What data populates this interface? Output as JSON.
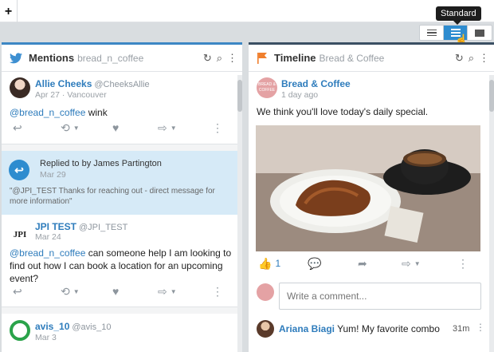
{
  "topbar": {
    "plus_label": "+"
  },
  "tooltip": {
    "label": "Standard"
  },
  "view_toggle": {
    "items": [
      "list",
      "standard",
      "wide"
    ],
    "active": "standard"
  },
  "mentions": {
    "title": "Mentions",
    "subtitle": "bread_n_coffee",
    "tweets": [
      {
        "name": "Allie Cheeks",
        "handle": "@CheeksAllie",
        "meta": "Apr 27 · Vancouver",
        "mention": "@bread_n_coffee",
        "text": " wink"
      },
      {
        "name": "JPI TEST",
        "handle": "@JPI_TEST",
        "meta": "Mar 24",
        "mention": "@bread_n_coffee",
        "text": " can someone help I am looking to find out how I can book a location for an upcoming event?"
      },
      {
        "name": "avis_10",
        "handle": "@avis_10",
        "meta": "Mar 3"
      }
    ],
    "reply": {
      "label": "Replied to by James Partington",
      "date": "Mar 29",
      "quote": "\"@JPI_TEST Thanks for reaching out - direct message for more information\""
    },
    "jpi_avatar_text": "JPI"
  },
  "timeline": {
    "title": "Timeline",
    "subtitle": "Bread & Coffee",
    "post": {
      "name": "Bread & Coffee",
      "meta": "1 day ago",
      "text": "We think you'll love today's daily special.",
      "like_count": "1",
      "avatar_text": "BREAD & COFFEE"
    },
    "comment_placeholder": "Write a comment...",
    "comment": {
      "name": "Ariana Biagi",
      "text": "Yum! My favorite combo",
      "time": "31m"
    }
  },
  "colors": {
    "accent": "#2e8ccf",
    "link": "#2e7cbc",
    "reply_bg": "#d6eaf7",
    "timeline_flag": "#f07f2d"
  }
}
